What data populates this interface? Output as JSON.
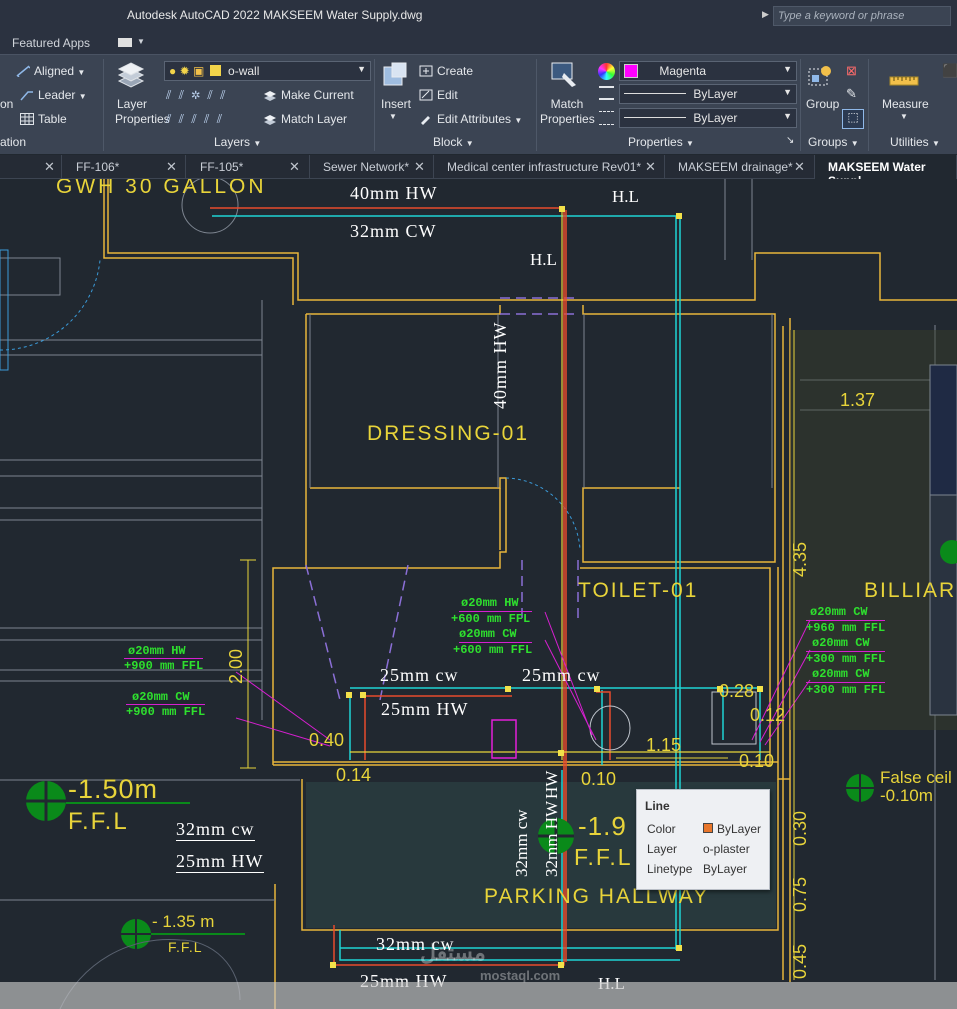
{
  "window": {
    "title": "Autodesk AutoCAD 2022    MAKSEEM Water Supply.dwg",
    "search_placeholder": "Type a keyword or phrase"
  },
  "ribbon_tabs": {
    "featured": "Featured Apps"
  },
  "ribbon": {
    "annotation": {
      "aligned": "Aligned",
      "leader": "Leader",
      "table": "Table",
      "on_fragment": "on",
      "panel": "ation"
    },
    "layers": {
      "layer_properties": "Layer Properties",
      "current_layer": "o-wall",
      "make_current": "Make Current",
      "match_layer": "Match Layer",
      "panel": "Layers"
    },
    "block": {
      "insert": "Insert",
      "create": "Create",
      "edit": "Edit",
      "edit_attributes": "Edit Attributes",
      "panel": "Block"
    },
    "properties": {
      "match_properties": "Match Properties",
      "color": "Magenta",
      "color_hex": "#ff00ff",
      "lineweight": "ByLayer",
      "linetype": "ByLayer",
      "panel": "Properties"
    },
    "groups": {
      "group": "Group",
      "panel": "Groups"
    },
    "utilities": {
      "measure": "Measure",
      "panel": "Utilities"
    }
  },
  "doc_tabs": [
    {
      "label": "FF-106*"
    },
    {
      "label": "FF-105*"
    },
    {
      "label": "Sewer Network*"
    },
    {
      "label": "Medical center infrastructure Rev01*"
    },
    {
      "label": "MAKSEEM drainage*"
    },
    {
      "label": "MAKSEEM Water Suppl"
    }
  ],
  "drawing": {
    "labels": {
      "gwh": "GWH 30 GALLON",
      "hw40_top": "40mm HW",
      "cw32_top": "32mm CW",
      "hl1": "H.L",
      "hl2": "H.L",
      "hl3": "H.L",
      "hw40_vert": "40mm HW",
      "dressing": "DRESSING-01",
      "toilet": "TOILET-01",
      "billiard": "BILLIARD",
      "parking": "PARKING HALLWAY",
      "dim_137": "1.37",
      "dim_435": "4.35",
      "dim_200": "2.00",
      "dim_040": "0.40",
      "dim_014": "0.14",
      "dim_010": "0.10",
      "dim_115": "1.15",
      "dim_028": "0.28",
      "dim_012": "0.12",
      "dim_0105": "0.10",
      "dim_030": "0.30",
      "dim_075": "0.75",
      "dim_045": "0.45",
      "cw25_a": "25mm cw",
      "cw25_b": "25mm cw",
      "hw25_a": "25mm HW",
      "cw32_vert": "32mm cw",
      "hw32_vert": "32mm HW",
      "hw25_vert": "HW",
      "cw32_left": "32mm cw",
      "hw25_left": "25mm HW",
      "cw32_bottom": "32mm cw",
      "hw25_bottom": "25mm HW",
      "lvl1": "-1.50m",
      "lvl1_ffl": "F.F.L",
      "lvl2": "-1.9",
      "lvl2_ffl": "F.F.L",
      "lvl3": "- 1.35 m",
      "lvl3_ffl": "F.F.L",
      "false_ceil": "False ceil",
      "false_ceil_lvl": "-0.10m"
    },
    "green_notes": [
      "ø20mm HW",
      "+600 mm FFL",
      "ø20mm CW",
      "+600 mm FFL",
      "ø20mm HW",
      "+900 mm FFL",
      "ø20mm CW",
      "+900 mm FFL",
      "ø20mm CW",
      "+960 mm FFL",
      "ø20mm CW",
      "+300 mm FFL",
      "ø20mm CW",
      "+300 mm FFL"
    ]
  },
  "tooltip": {
    "title": "Line",
    "color_label": "Color",
    "color_value": "ByLayer",
    "color_hex": "#e8762b",
    "layer_label": "Layer",
    "layer_value": "o-plaster",
    "linetype_label": "Linetype",
    "linetype_value": "ByLayer"
  },
  "watermark": {
    "arabic": "مستقل",
    "latin": "mostaql.com"
  }
}
